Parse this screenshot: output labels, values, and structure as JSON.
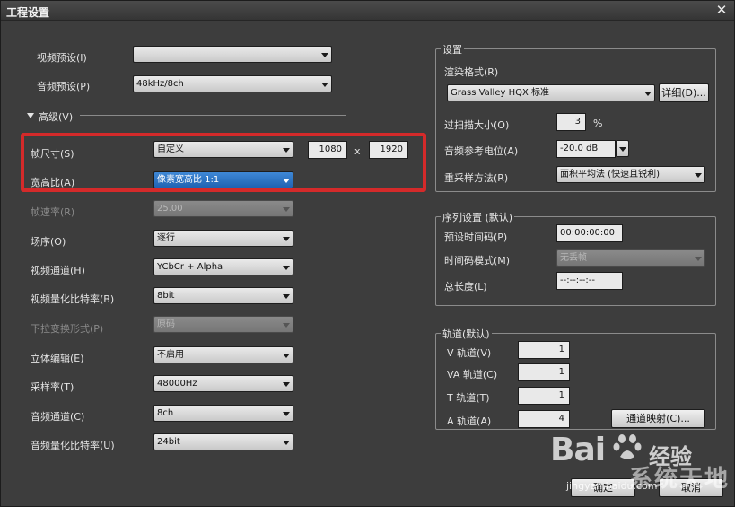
{
  "window": {
    "title": "工程设置",
    "close_label": "✕"
  },
  "left": {
    "video_preset": {
      "label": "视频预设(I)",
      "value": ""
    },
    "audio_preset": {
      "label": "音频预设(P)",
      "value": "48kHz/8ch"
    },
    "advanced_label": "高级(V)",
    "frame_size": {
      "label": "帧尺寸(S)",
      "value": "自定义",
      "width": "1080",
      "x": "x",
      "height": "1920"
    },
    "aspect": {
      "label": "宽高比(A)",
      "value": "像素宽高比 1:1"
    },
    "frame_rate": {
      "label": "帧速率(R)",
      "value": "25.00"
    },
    "field_order": {
      "label": "场序(O)",
      "value": "逐行"
    },
    "video_channel": {
      "label": "视频通道(H)",
      "value": "YCbCr + Alpha"
    },
    "video_bit": {
      "label": "视频量化比特率(B)",
      "value": "8bit"
    },
    "pulldown": {
      "label": "下拉变换形式(P)",
      "value": "原码"
    },
    "stereo": {
      "label": "立体编辑(E)",
      "value": "不启用"
    },
    "sample_rate": {
      "label": "采样率(T)",
      "value": "48000Hz"
    },
    "audio_channel": {
      "label": "音频通道(C)",
      "value": "8ch"
    },
    "audio_bit": {
      "label": "音频量化比特率(U)",
      "value": "24bit"
    }
  },
  "settings": {
    "title": "设置",
    "render_label": "渲染格式(R)",
    "render_value": "Grass Valley HQX 标准",
    "detail_button": "详细(D)...",
    "overscan_label": "过扫描大小(O)",
    "overscan_value": "3",
    "overscan_unit": "%",
    "ref_level_label": "音频参考电位(A)",
    "ref_level_value": "-20.0 dB",
    "resample_label": "重采样方法(R)",
    "resample_value": "面积平均法 (快速且锐利)"
  },
  "sequence": {
    "title": "序列设置 (默认)",
    "timecode_label": "预设时间码(P)",
    "timecode_value": "00:00:00:00",
    "mode_label": "时间码模式(M)",
    "mode_value": "无丢帧",
    "duration_label": "总长度(L)",
    "duration_value": "--:--:--:--"
  },
  "tracks": {
    "title": "轨道(默认)",
    "v_label": "V 轨道(V)",
    "v_value": "1",
    "va_label": "VA 轨道(C)",
    "va_value": "1",
    "t_label": "T 轨道(T)",
    "t_value": "1",
    "a_label": "A 轨道(A)",
    "a_value": "4",
    "map_button": "通道映射(C)..."
  },
  "footer": {
    "ok": "确定",
    "cancel": "取消"
  },
  "watermark": {
    "logo": "Bai",
    "logo2": "经验",
    "url": "jingyan.baidu.com",
    "site": "系统天地"
  }
}
